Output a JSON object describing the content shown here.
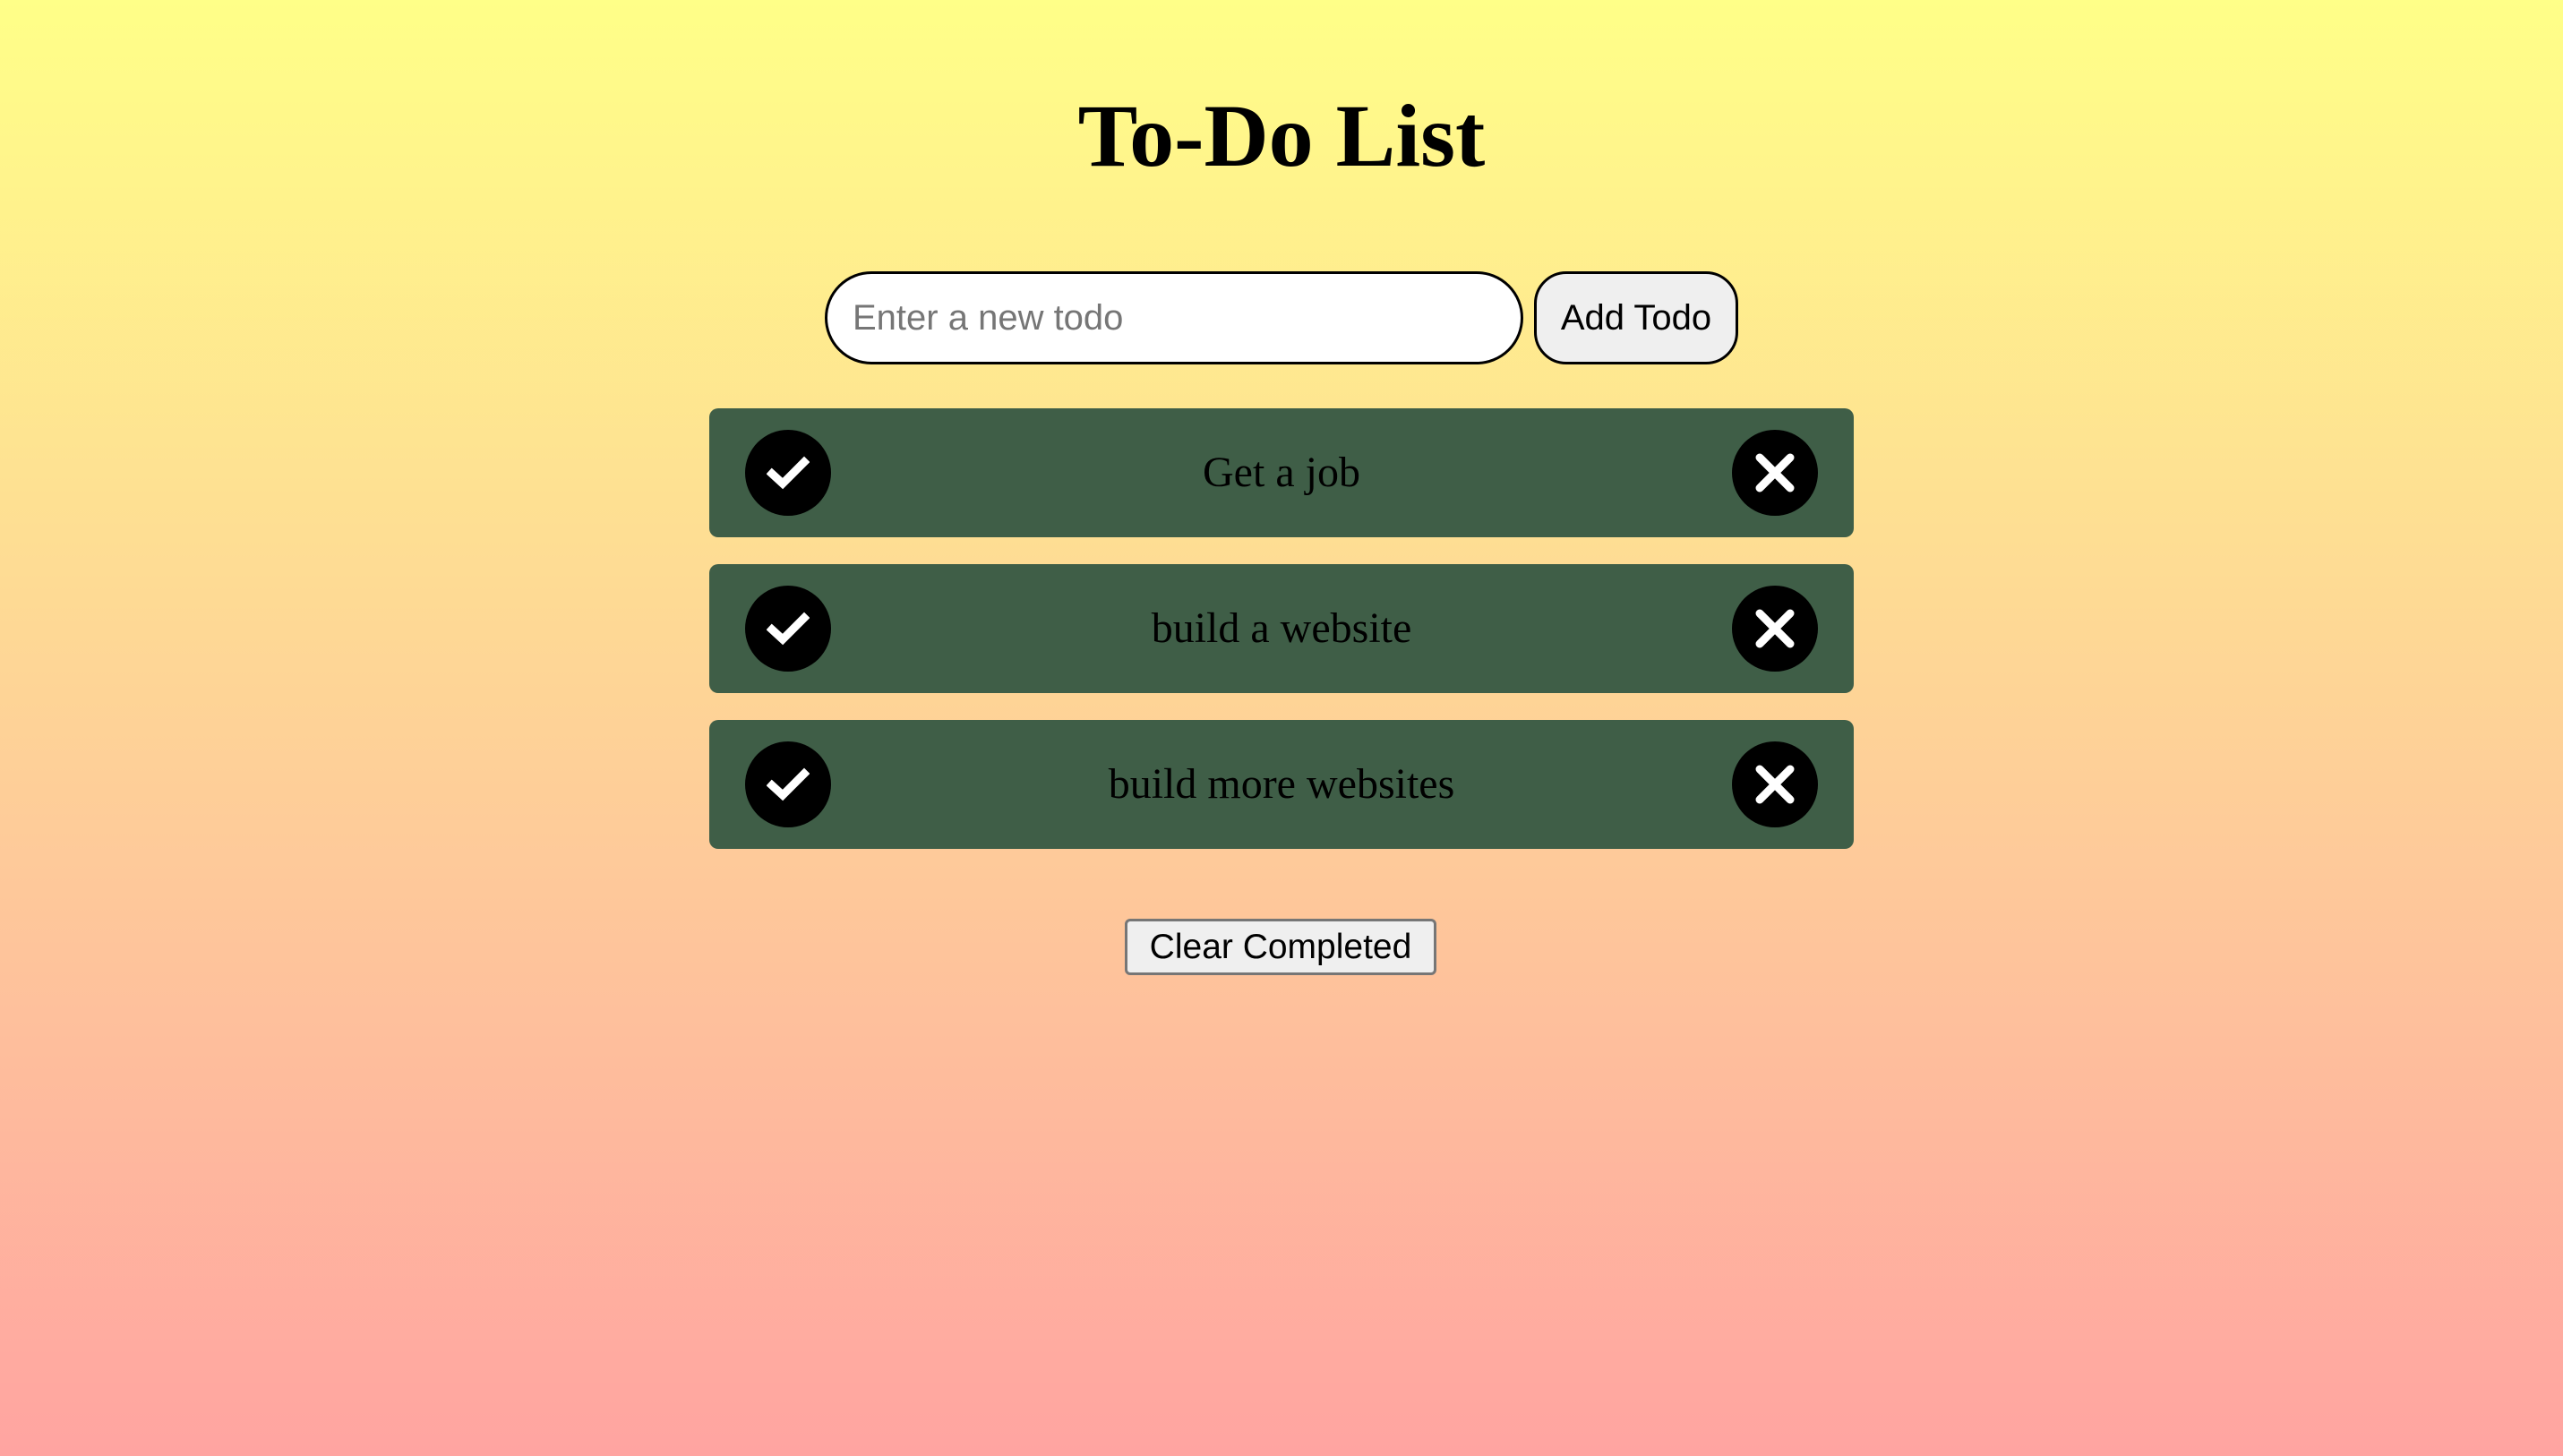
{
  "app": {
    "title": "To-Do List"
  },
  "new_todo": {
    "placeholder": "Enter a new todo",
    "value": "",
    "add_label": "Add Todo"
  },
  "todos": [
    {
      "text": "Get a job",
      "check_icon": "check-icon",
      "delete_icon": "close-icon"
    },
    {
      "text": "build a website",
      "check_icon": "check-icon",
      "delete_icon": "close-icon"
    },
    {
      "text": "build more websites",
      "check_icon": "check-icon",
      "delete_icon": "close-icon"
    }
  ],
  "footer": {
    "clear_label": "Clear Completed"
  },
  "colors": {
    "background_top": "#ffff88",
    "background_bottom": "#ffa4a1",
    "item_background": "#3f5e47",
    "icon_circle": "#000000",
    "icon_glyph": "#ffffff"
  }
}
